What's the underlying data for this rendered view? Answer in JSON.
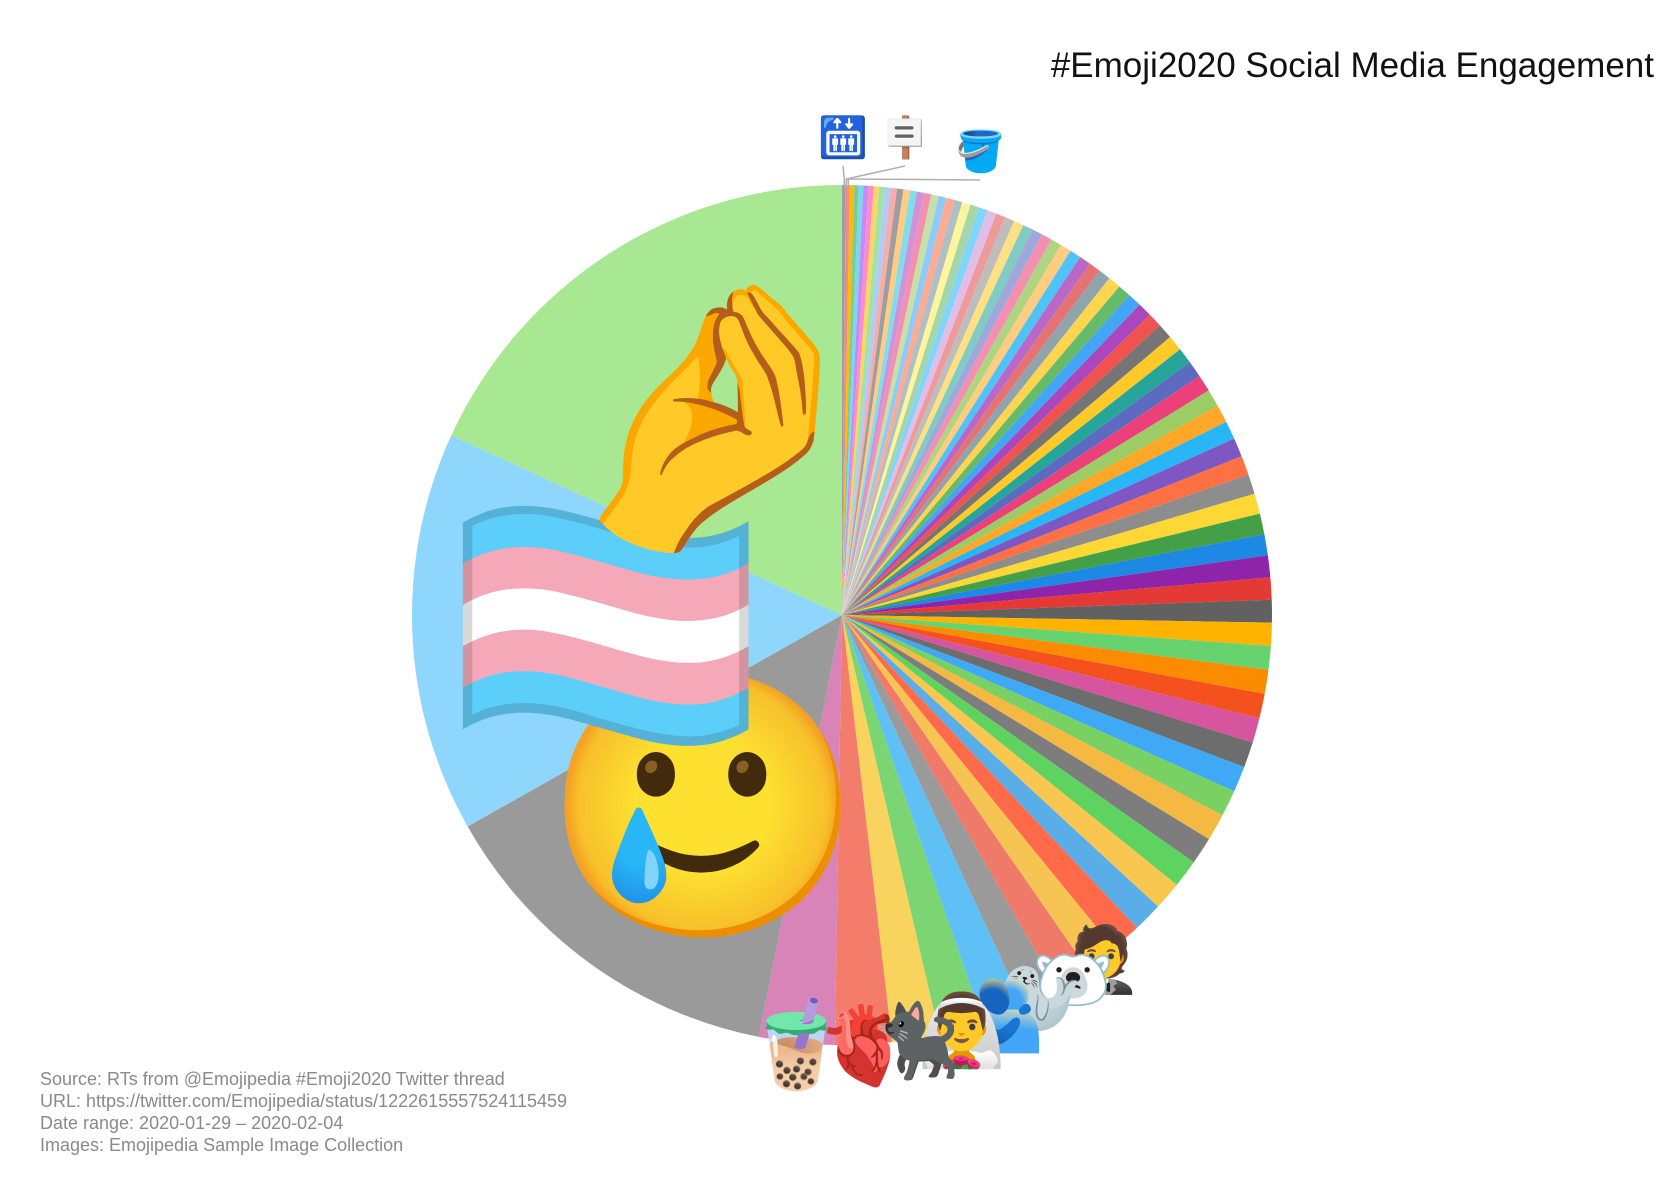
{
  "page": {
    "title": "#Emoji2020 Social Media Engagement",
    "footer": {
      "source": "Source: RTs from @Emojipedia #Emoji2020 Twitter thread",
      "url": "URL: https://twitter.com/Emojipedia/status/1222615557524115459",
      "date_range": "Date range: 2020-01-29 – 2020-02-04",
      "images": "Images: Emojipedia Sample Image Collection"
    }
  },
  "chart_data": {
    "type": "pie",
    "title": "#Emoji2020 Social Media Engagement",
    "start_angle_deg": 0,
    "direction": "clockwise",
    "labels_as_emoji_images": true,
    "slices": [
      {
        "emoji": "",
        "value": 0.16,
        "color": "#9aa0a6"
      },
      {
        "emoji": "",
        "value": 0.17,
        "color": "#f28b82"
      },
      {
        "emoji": "",
        "value": 0.18,
        "color": "#fbbc04"
      },
      {
        "emoji": "",
        "value": 0.19,
        "color": "#81c995"
      },
      {
        "emoji": "",
        "value": 0.2,
        "color": "#78d9ec"
      },
      {
        "emoji": "",
        "value": 0.21,
        "color": "#c58af9"
      },
      {
        "emoji": "",
        "value": 0.22,
        "color": "#ff8bcb"
      },
      {
        "emoji": "",
        "value": 0.23,
        "color": "#fdd663"
      },
      {
        "emoji": "",
        "value": 0.24,
        "color": "#a1e3a1"
      },
      {
        "emoji": "",
        "value": 0.25,
        "color": "#aecbfa"
      },
      {
        "emoji": "",
        "value": 0.26,
        "color": "#f6aea9"
      },
      {
        "emoji": "",
        "value": 0.27,
        "color": "#9e9e9e"
      },
      {
        "emoji": "",
        "value": 0.28,
        "color": "#ffcc80"
      },
      {
        "emoji": "",
        "value": 0.29,
        "color": "#80deea"
      },
      {
        "emoji": "",
        "value": 0.3,
        "color": "#ce93d8"
      },
      {
        "emoji": "",
        "value": 0.31,
        "color": "#f48fb1"
      },
      {
        "emoji": "",
        "value": 0.32,
        "color": "#c5e1a5"
      },
      {
        "emoji": "",
        "value": 0.33,
        "color": "#90caf9"
      },
      {
        "emoji": "",
        "value": 0.34,
        "color": "#ffab91"
      },
      {
        "emoji": "",
        "value": 0.35,
        "color": "#b0bec5"
      },
      {
        "emoji": "",
        "value": 0.36,
        "color": "#fff59d"
      },
      {
        "emoji": "",
        "value": 0.37,
        "color": "#a5d6a7"
      },
      {
        "emoji": "",
        "value": 0.38,
        "color": "#81d4fa"
      },
      {
        "emoji": "",
        "value": 0.39,
        "color": "#e1bee7"
      },
      {
        "emoji": "",
        "value": 0.4,
        "color": "#ef9a9a"
      },
      {
        "emoji": "",
        "value": 0.41,
        "color": "#bdbdbd"
      },
      {
        "emoji": "",
        "value": 0.42,
        "color": "#ffe082"
      },
      {
        "emoji": "",
        "value": 0.43,
        "color": "#80cbc4"
      },
      {
        "emoji": "",
        "value": 0.44,
        "color": "#9fa8da"
      },
      {
        "emoji": "",
        "value": 0.45,
        "color": "#f48fb1"
      },
      {
        "emoji": "",
        "value": 0.46,
        "color": "#aed581"
      },
      {
        "emoji": "",
        "value": 0.47,
        "color": "#ffcc80"
      },
      {
        "emoji": "",
        "value": 0.48,
        "color": "#4fc3f7"
      },
      {
        "emoji": "",
        "value": 0.49,
        "color": "#ba68c8"
      },
      {
        "emoji": "",
        "value": 0.5,
        "color": "#e57373"
      },
      {
        "emoji": "",
        "value": 0.52,
        "color": "#90a4ae"
      },
      {
        "emoji": "",
        "value": 0.54,
        "color": "#ffd54f"
      },
      {
        "emoji": "",
        "value": 0.56,
        "color": "#66bb6a"
      },
      {
        "emoji": "",
        "value": 0.58,
        "color": "#42a5f5"
      },
      {
        "emoji": "",
        "value": 0.6,
        "color": "#ab47bc"
      },
      {
        "emoji": "",
        "value": 0.62,
        "color": "#ef5350"
      },
      {
        "emoji": "",
        "value": 0.64,
        "color": "#757575"
      },
      {
        "emoji": "",
        "value": 0.66,
        "color": "#ffca28"
      },
      {
        "emoji": "",
        "value": 0.68,
        "color": "#26a69a"
      },
      {
        "emoji": "",
        "value": 0.7,
        "color": "#5c6bc0"
      },
      {
        "emoji": "",
        "value": 0.72,
        "color": "#ec407a"
      },
      {
        "emoji": "",
        "value": 0.74,
        "color": "#9ccc65"
      },
      {
        "emoji": "",
        "value": 0.76,
        "color": "#ffa726"
      },
      {
        "emoji": "",
        "value": 0.78,
        "color": "#29b6f6"
      },
      {
        "emoji": "",
        "value": 0.8,
        "color": "#7e57c2"
      },
      {
        "emoji": "",
        "value": 0.82,
        "color": "#ff7043"
      },
      {
        "emoji": "",
        "value": 0.84,
        "color": "#8d8d8d"
      },
      {
        "emoji": "",
        "value": 0.86,
        "color": "#fdd835"
      },
      {
        "emoji": "",
        "value": 0.88,
        "color": "#43a047"
      },
      {
        "emoji": "",
        "value": 0.9,
        "color": "#1e88e5"
      },
      {
        "emoji": "",
        "value": 0.92,
        "color": "#8e24aa"
      },
      {
        "emoji": "",
        "value": 0.94,
        "color": "#e53935"
      },
      {
        "emoji": "",
        "value": 0.96,
        "color": "#616161"
      },
      {
        "emoji": "",
        "value": 0.98,
        "color": "#ffb300"
      },
      {
        "emoji": "",
        "value": 1.0,
        "color": "#66d36e"
      },
      {
        "emoji": "",
        "value": 1.02,
        "color": "#fb8c00"
      },
      {
        "emoji": "",
        "value": 1.04,
        "color": "#f4511e"
      },
      {
        "emoji": "",
        "value": 1.06,
        "color": "#d6559e"
      },
      {
        "emoji": "",
        "value": 1.08,
        "color": "#6d6d6d"
      },
      {
        "emoji": "",
        "value": 1.1,
        "color": "#3fa9f5"
      },
      {
        "emoji": "",
        "value": 1.12,
        "color": "#78d162"
      },
      {
        "emoji": "",
        "value": 1.14,
        "color": "#f5b942"
      },
      {
        "emoji": "",
        "value": 1.16,
        "color": "#7d7d7d"
      },
      {
        "emoji": "",
        "value": 1.18,
        "color": "#5fd35f"
      },
      {
        "emoji": "",
        "value": 1.2,
        "color": "#f9c74f"
      },
      {
        "emoji": "",
        "value": 1.25,
        "color": "#5aaee8"
      },
      {
        "emoji": "",
        "value": 1.3,
        "color": "#ff6b4a"
      },
      {
        "emoji": "🤵",
        "value": 1.4,
        "color": "#f6c453"
      },
      {
        "emoji": "🐻‍❄️",
        "value": 1.5,
        "color": "#f07a6a"
      },
      {
        "emoji": "🦭",
        "value": 1.6,
        "color": "#9a9a9a"
      },
      {
        "emoji": "🫂",
        "value": 1.8,
        "color": "#5fc0f5"
      },
      {
        "emoji": "👰‍♂️",
        "value": 1.9,
        "color": "#7ad572"
      },
      {
        "emoji": "🐈‍⬛",
        "value": 2.0,
        "color": "#f8d35e"
      },
      {
        "emoji": "🫀",
        "value": 2.4,
        "color": "#f47c6a"
      },
      {
        "emoji": "🧋",
        "value": 3.2,
        "color": "#d884b8"
      },
      {
        "emoji": "🥲",
        "value": 15.5,
        "color": "#9a9a9a"
      },
      {
        "emoji": "🏳️‍⚧️",
        "value": 17.0,
        "color": "#8ed6fb"
      },
      {
        "emoji": "🤌",
        "value": 20.5,
        "color": "#a8e892"
      }
    ],
    "callouts": [
      {
        "emoji": "🛗"
      },
      {
        "emoji": "🪧"
      },
      {
        "emoji": "🪣"
      }
    ]
  }
}
